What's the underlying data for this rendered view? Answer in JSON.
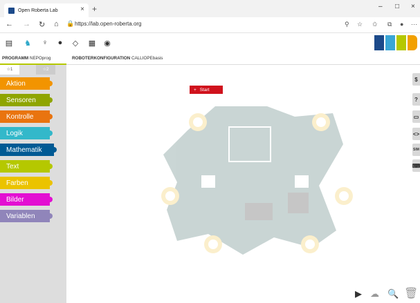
{
  "browser": {
    "tab_title": "Open Roberta Lab",
    "tab_close": "×",
    "new_tab": "+",
    "minimize": "–",
    "maximize": "□",
    "close": "×",
    "back": "←",
    "forward": "→",
    "reload": "↻",
    "home": "⌂",
    "url": "https://lab.open-roberta.org",
    "lock": "🔒"
  },
  "toolbar": {
    "logo_colors": [
      "#1c4a8a",
      "#39a6d6",
      "#b5c800",
      "#f2a000"
    ]
  },
  "app_tabs": {
    "program_bold": "PROGRAMM",
    "program_name": "NEPOprog",
    "robot_bold": "ROBOTERKONFIGURATION",
    "robot_name": "CALLIOPEbasis"
  },
  "levels": [
    "☆1",
    "☆2"
  ],
  "categories": [
    {
      "label": "Aktion",
      "color": "#f29400"
    },
    {
      "label": "Sensoren",
      "color": "#8fa500"
    },
    {
      "label": "Kontrolle",
      "color": "#e9740f"
    },
    {
      "label": "Logik",
      "color": "#33b8ca"
    },
    {
      "label": "Mathematik",
      "color": "#005a94"
    },
    {
      "label": "Text",
      "color": "#b5c800"
    },
    {
      "label": "Farben",
      "color": "#ebc300"
    },
    {
      "label": "Bilder",
      "color": "#e30fd2"
    },
    {
      "label": "Variablen",
      "color": "#9085ba"
    }
  ],
  "canvas": {
    "start_label": "Start"
  },
  "right_panel": [
    "$",
    "?",
    "▭",
    "<>",
    "SIM",
    "⌨"
  ],
  "bottom": {
    "run": "▶",
    "cloud": "☁",
    "zoom": "🔍",
    "trash": "🗑"
  }
}
